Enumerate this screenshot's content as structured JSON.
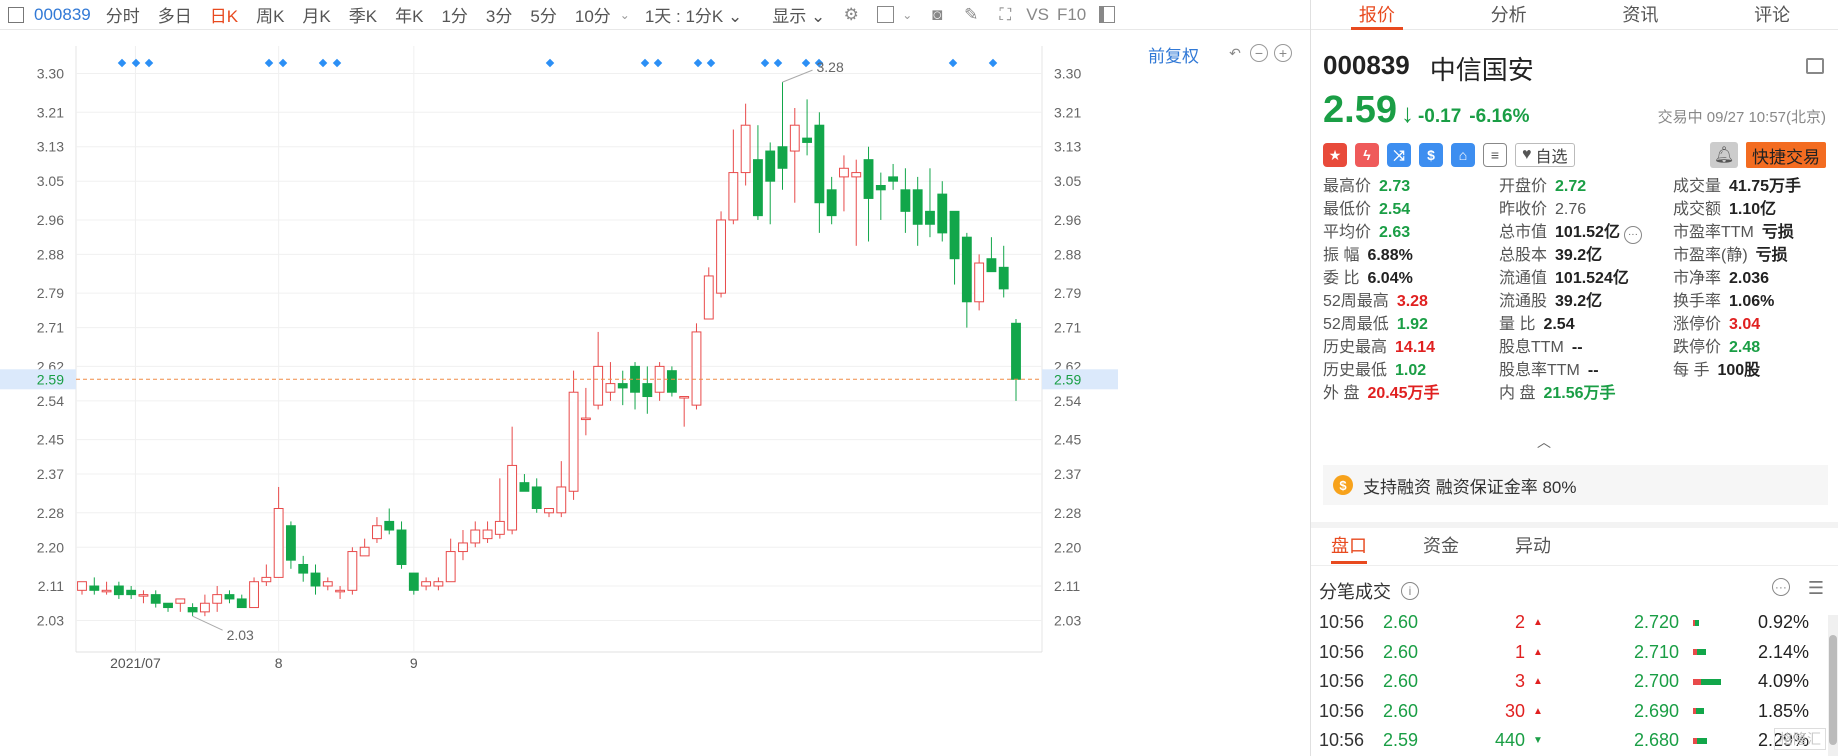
{
  "toolbar": {
    "code": "000839",
    "items": [
      "分时",
      "多日",
      "日K",
      "周K",
      "月K",
      "季K",
      "年K",
      "1分",
      "3分",
      "5分",
      "10分"
    ],
    "active": "日K",
    "range": "1天 : 1分K",
    "display": "显示",
    "vs": "VS",
    "f10": "F10"
  },
  "chart": {
    "adj_label": "前复权",
    "current_price_label": "2.59",
    "max_label": "3.28",
    "min_label": "2.03"
  },
  "chart_data": {
    "type": "candlestick",
    "x_labels": [
      {
        "index": 5,
        "label": "2021/07"
      },
      {
        "index": 16,
        "label": "8"
      },
      {
        "index": 27,
        "label": "9"
      }
    ],
    "y_ticks": [
      2.03,
      2.11,
      2.2,
      2.28,
      2.37,
      2.45,
      2.54,
      2.62,
      2.71,
      2.79,
      2.88,
      2.96,
      3.05,
      3.13,
      3.21,
      3.3
    ],
    "ylim": [
      1.98,
      3.35
    ],
    "current_price": 2.59,
    "dot_indices": [
      1,
      2,
      3,
      8,
      9,
      11,
      12,
      18,
      22,
      23,
      25,
      26,
      28,
      29,
      30,
      31,
      36,
      37
    ],
    "candles": [
      [
        2.1,
        2.12,
        2.12,
        2.09
      ],
      [
        2.11,
        2.1,
        2.13,
        2.09
      ],
      [
        2.1,
        2.1,
        2.12,
        2.09
      ],
      [
        2.11,
        2.09,
        2.12,
        2.08
      ],
      [
        2.1,
        2.09,
        2.11,
        2.08
      ],
      [
        2.09,
        2.09,
        2.1,
        2.07
      ],
      [
        2.09,
        2.07,
        2.1,
        2.06
      ],
      [
        2.07,
        2.06,
        2.07,
        2.05
      ],
      [
        2.07,
        2.08,
        2.08,
        2.05
      ],
      [
        2.06,
        2.05,
        2.07,
        2.04
      ],
      [
        2.05,
        2.07,
        2.09,
        2.04
      ],
      [
        2.07,
        2.09,
        2.11,
        2.05
      ],
      [
        2.09,
        2.08,
        2.1,
        2.07
      ],
      [
        2.08,
        2.06,
        2.09,
        2.06
      ],
      [
        2.06,
        2.12,
        2.13,
        2.06
      ],
      [
        2.12,
        2.13,
        2.16,
        2.11
      ],
      [
        2.13,
        2.29,
        2.34,
        2.13
      ],
      [
        2.25,
        2.17,
        2.26,
        2.15
      ],
      [
        2.16,
        2.14,
        2.18,
        2.12
      ],
      [
        2.14,
        2.11,
        2.16,
        2.09
      ],
      [
        2.11,
        2.12,
        2.13,
        2.1
      ],
      [
        2.1,
        2.1,
        2.11,
        2.08
      ],
      [
        2.1,
        2.19,
        2.2,
        2.09
      ],
      [
        2.18,
        2.2,
        2.22,
        2.18
      ],
      [
        2.22,
        2.25,
        2.27,
        2.21
      ],
      [
        2.26,
        2.24,
        2.29,
        2.23
      ],
      [
        2.24,
        2.16,
        2.26,
        2.15
      ],
      [
        2.14,
        2.1,
        2.14,
        2.09
      ],
      [
        2.11,
        2.12,
        2.13,
        2.1
      ],
      [
        2.11,
        2.12,
        2.13,
        2.1
      ],
      [
        2.12,
        2.19,
        2.22,
        2.12
      ],
      [
        2.19,
        2.21,
        2.24,
        2.17
      ],
      [
        2.21,
        2.24,
        2.26,
        2.2
      ],
      [
        2.22,
        2.24,
        2.26,
        2.21
      ],
      [
        2.23,
        2.26,
        2.36,
        2.22
      ],
      [
        2.24,
        2.39,
        2.48,
        2.23
      ],
      [
        2.35,
        2.33,
        2.37,
        2.33
      ],
      [
        2.34,
        2.29,
        2.36,
        2.28
      ],
      [
        2.28,
        2.29,
        2.29,
        2.27
      ],
      [
        2.28,
        2.34,
        2.4,
        2.27
      ],
      [
        2.33,
        2.56,
        2.61,
        2.31
      ],
      [
        2.5,
        2.5,
        2.57,
        2.46
      ],
      [
        2.53,
        2.62,
        2.7,
        2.52
      ],
      [
        2.56,
        2.58,
        2.63,
        2.54
      ],
      [
        2.58,
        2.57,
        2.61,
        2.53
      ],
      [
        2.62,
        2.56,
        2.63,
        2.52
      ],
      [
        2.58,
        2.55,
        2.62,
        2.51
      ],
      [
        2.56,
        2.62,
        2.63,
        2.54
      ],
      [
        2.61,
        2.56,
        2.62,
        2.55
      ],
      [
        2.55,
        2.55,
        2.55,
        2.48
      ],
      [
        2.53,
        2.7,
        2.72,
        2.52
      ],
      [
        2.73,
        2.83,
        2.85,
        2.73
      ],
      [
        2.79,
        2.96,
        2.98,
        2.78
      ],
      [
        2.96,
        3.07,
        3.17,
        2.95
      ],
      [
        3.07,
        3.18,
        3.23,
        3.04
      ],
      [
        3.1,
        2.97,
        3.18,
        2.96
      ],
      [
        3.12,
        3.05,
        3.14,
        2.95
      ],
      [
        3.13,
        3.08,
        3.28,
        3.03
      ],
      [
        3.12,
        3.18,
        3.22,
        3.0
      ],
      [
        3.15,
        3.14,
        3.24,
        3.11
      ],
      [
        3.18,
        3.0,
        3.21,
        2.93
      ],
      [
        3.03,
        2.97,
        3.06,
        2.95
      ],
      [
        3.06,
        3.08,
        3.11,
        2.98
      ],
      [
        3.06,
        3.07,
        3.1,
        2.9
      ],
      [
        3.1,
        3.01,
        3.13,
        2.91
      ],
      [
        3.04,
        3.03,
        3.07,
        2.96
      ],
      [
        3.06,
        3.05,
        3.09,
        3.03
      ],
      [
        3.03,
        2.98,
        3.08,
        2.93
      ],
      [
        3.03,
        2.95,
        3.06,
        2.9
      ],
      [
        2.98,
        2.95,
        3.08,
        2.92
      ],
      [
        3.02,
        2.93,
        3.05,
        2.91
      ],
      [
        2.98,
        2.87,
        2.97,
        2.81
      ],
      [
        2.92,
        2.77,
        2.93,
        2.71
      ],
      [
        2.77,
        2.86,
        2.88,
        2.75
      ],
      [
        2.87,
        2.84,
        2.92,
        2.84
      ],
      [
        2.85,
        2.8,
        2.9,
        2.78
      ],
      [
        2.72,
        2.59,
        2.73,
        2.54
      ]
    ]
  },
  "quote": {
    "code": "000839",
    "name": "中信国安",
    "price": "2.59",
    "arrow": "↓",
    "change": "-0.17",
    "pct": "-6.16%",
    "status": "交易中 09/27 10:57(北京)",
    "watch": "自选",
    "trade": "快捷交易"
  },
  "tabs": [
    "报价",
    "分析",
    "资讯",
    "评论"
  ],
  "stats": [
    {
      "l": "最高价",
      "v": "2.73",
      "c": "green"
    },
    {
      "l": "开盘价",
      "v": "2.72",
      "c": "green"
    },
    {
      "l": "成交量",
      "v": "41.75万手",
      "c": ""
    },
    {
      "l": "最低价",
      "v": "2.54",
      "c": "green"
    },
    {
      "l": "昨收价",
      "v": "2.76",
      "c": "gray"
    },
    {
      "l": "成交额",
      "v": "1.10亿",
      "c": ""
    },
    {
      "l": "平均价",
      "v": "2.63",
      "c": "green"
    },
    {
      "l": "总市值",
      "v": "101.52亿",
      "c": ""
    },
    {
      "l": "市盈率TTM",
      "v": "亏损",
      "c": ""
    },
    {
      "l": "振 幅",
      "v": "6.88%",
      "c": ""
    },
    {
      "l": "总股本",
      "v": "39.2亿",
      "c": ""
    },
    {
      "l": "市盈率(静)",
      "v": "亏损",
      "c": ""
    },
    {
      "l": "委 比",
      "v": "6.04%",
      "c": ""
    },
    {
      "l": "流通值",
      "v": "101.524亿",
      "c": ""
    },
    {
      "l": "市净率",
      "v": "2.036",
      "c": ""
    },
    {
      "l": "52周最高",
      "v": "3.28",
      "c": "red"
    },
    {
      "l": "流通股",
      "v": "39.2亿",
      "c": ""
    },
    {
      "l": "换手率",
      "v": "1.06%",
      "c": ""
    },
    {
      "l": "52周最低",
      "v": "1.92",
      "c": "green"
    },
    {
      "l": "量 比",
      "v": "2.54",
      "c": ""
    },
    {
      "l": "涨停价",
      "v": "3.04",
      "c": "red"
    },
    {
      "l": "历史最高",
      "v": "14.14",
      "c": "red"
    },
    {
      "l": "股息TTM",
      "v": "--",
      "c": ""
    },
    {
      "l": "跌停价",
      "v": "2.48",
      "c": "green"
    },
    {
      "l": "历史最低",
      "v": "1.02",
      "c": "green"
    },
    {
      "l": "股息率TTM",
      "v": "--",
      "c": ""
    },
    {
      "l": "每 手",
      "v": "100股",
      "c": ""
    },
    {
      "l": "外 盘",
      "v": "20.45万手",
      "c": "red"
    },
    {
      "l": "内 盘",
      "v": "21.56万手",
      "c": "green"
    }
  ],
  "margin_text": "支持融资 融资保证金率 80%",
  "bottom_tabs": [
    "盘口",
    "资金",
    "异动"
  ],
  "ticks_title": "分笔成交",
  "ticks": [
    {
      "time": "10:56",
      "price": "2.60",
      "vol": "2",
      "dir": "up",
      "level": "2.720",
      "pct": "0.92%",
      "bar": 0.2
    },
    {
      "time": "10:56",
      "price": "2.60",
      "vol": "1",
      "dir": "up",
      "level": "2.710",
      "pct": "2.14%",
      "bar": 0.45
    },
    {
      "time": "10:56",
      "price": "2.60",
      "vol": "3",
      "dir": "up",
      "level": "2.700",
      "pct": "4.09%",
      "bar": 1.0
    },
    {
      "time": "10:56",
      "price": "2.60",
      "vol": "30",
      "dir": "up",
      "level": "2.690",
      "pct": "1.85%",
      "bar": 0.4
    },
    {
      "time": "10:56",
      "price": "2.59",
      "vol": "440",
      "dir": "down",
      "level": "2.680",
      "pct": "2.29%",
      "bar": 0.5
    }
  ],
  "watermark": "格隆汇",
  "colors": {
    "up": "#e84a4a",
    "down": "#12a64a",
    "accent": "#e84a1f",
    "link": "#3179d6",
    "dot": "#2b8ff5"
  }
}
